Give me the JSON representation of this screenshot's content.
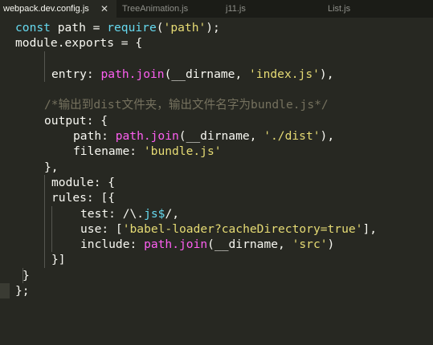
{
  "tabs": [
    {
      "label": "webpack.dev.config.js",
      "active": true,
      "close_glyph": "✕"
    },
    {
      "label": "TreeAnimation.js",
      "active": false
    },
    {
      "label": "j11.js",
      "active": false
    },
    {
      "label": "List.js",
      "active": false
    }
  ],
  "code": {
    "line1": {
      "kw": "const",
      "mid": " path = ",
      "fn": "require",
      "open": "(",
      "str": "'path'",
      "close": ");"
    },
    "line2": {
      "text": "module.exports = {"
    },
    "line4": {
      "prop": "entry: ",
      "fn": "path.join",
      "mid": "(__dirname, ",
      "str": "'index.js'",
      "close": "),"
    },
    "line5": {
      "comment": "/*输出到dist文件夹，输出文件名字为bundle.js*/"
    },
    "line6": {
      "text": "output: {"
    },
    "line7": {
      "prop": "path: ",
      "fn": "path.join",
      "mid": "(__dirname, ",
      "str": "'./dist'",
      "close": "),"
    },
    "line8": {
      "prop": "filename: ",
      "str": "'bundle.js'"
    },
    "line9": {
      "text": "},"
    },
    "line10": {
      "text": "module: {"
    },
    "line11": {
      "text": "rules: [{"
    },
    "line12": {
      "prop": "test: ",
      "regex_slash": "/\\.",
      "regex_kw": "js$",
      "regex_end": "/,"
    },
    "line13": {
      "prop": "use: [",
      "str": "'babel-loader?cacheDirectory=true'",
      "close": "],"
    },
    "line14": {
      "prop": "include: ",
      "fn": "path.join",
      "mid": "(__dirname, ",
      "str": "'src'",
      "close": ")"
    },
    "line15": {
      "text": "}]"
    },
    "line16": {
      "text": "}"
    },
    "line17": {
      "text": "};"
    }
  }
}
